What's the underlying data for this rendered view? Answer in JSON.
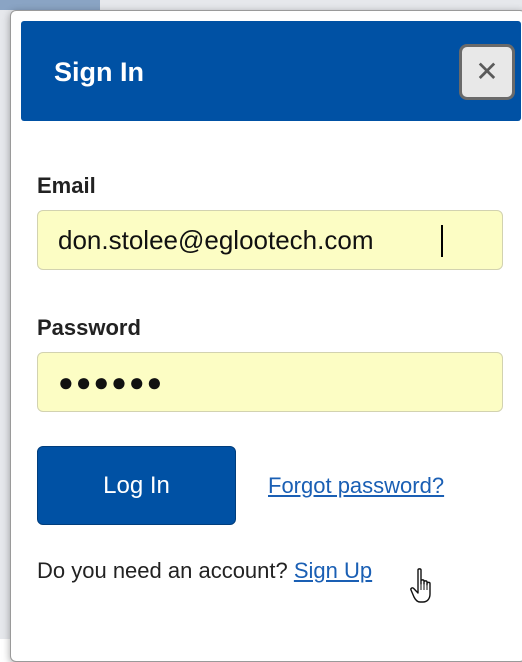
{
  "dialog": {
    "title": "Sign In",
    "close_icon": "close-icon"
  },
  "form": {
    "email_label": "Email",
    "email_value": "don.stolee@eglootech.com",
    "password_label": "Password",
    "password_value": "●●●●●●",
    "login_label": "Log In",
    "forgot_label": "Forgot password?",
    "account_prompt": "Do you need an account?",
    "signup_label": "Sign Up"
  },
  "colors": {
    "header_bg": "#0051a4",
    "button_bg": "#0051a4",
    "input_bg": "#fcfdc4",
    "link": "#1a5fb4"
  }
}
